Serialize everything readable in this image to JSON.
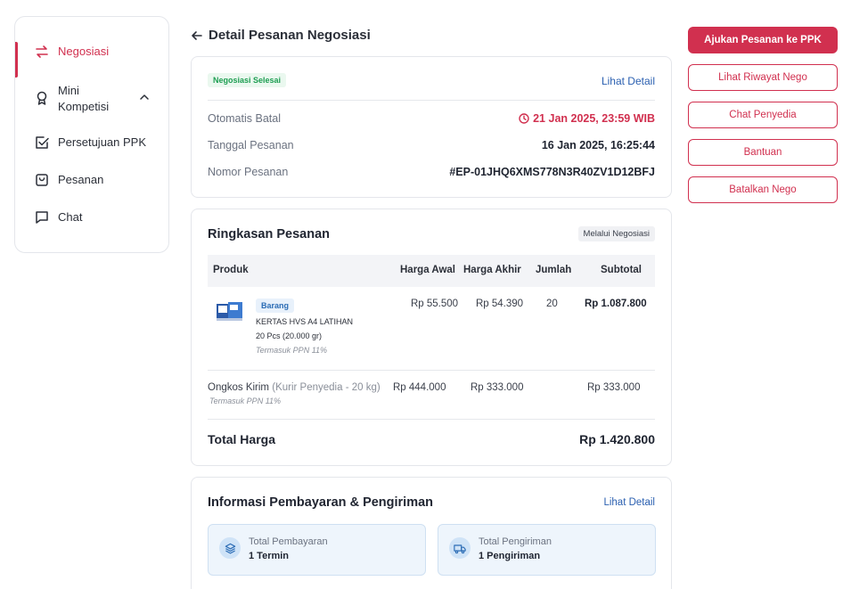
{
  "sidebar": {
    "items": [
      {
        "label": "Negosiasi",
        "icon": "arrows-swap-icon"
      },
      {
        "label": "Mini Kompetisi",
        "icon": "award-icon"
      },
      {
        "label": "Persetujuan PPK",
        "icon": "checkbox-icon"
      },
      {
        "label": "Pesanan",
        "icon": "shopping-bag-icon"
      },
      {
        "label": "Chat",
        "icon": "chat-icon"
      }
    ]
  },
  "header": {
    "title": "Detail Pesanan Negosiasi"
  },
  "status": {
    "badge": "Negosiasi Selesai",
    "detail_link": "Lihat Detail",
    "rows": [
      {
        "label": "Otomatis Batal",
        "value": "21 Jan 2025, 23:59 WIB"
      },
      {
        "label": "Tanggal Pesanan",
        "value": "16 Jan 2025, 16:25:44"
      },
      {
        "label": "Nomor Pesanan",
        "value": "#EP-01JHQ6XMS778N3R40ZV1D12BFJ"
      }
    ]
  },
  "summary": {
    "title": "Ringkasan Pesanan",
    "tag": "Melalui Negosiasi",
    "columns": [
      "Produk",
      "Harga Awal",
      "Harga Akhir",
      "Jumlah",
      "Subtotal"
    ],
    "product": {
      "type": "Barang",
      "name": "KERTAS HVS A4 LATIHAN",
      "qty_detail": "20 Pcs (20.000 gr)",
      "tax_note": "Termasuk PPN 11%",
      "harga_awal": "Rp 55.500",
      "harga_akhir": "Rp 54.390",
      "jumlah": "20",
      "subtotal": "Rp 1.087.800"
    },
    "shipping": {
      "label": "Ongkos Kirim",
      "detail": "(Kurir Penyedia - 20 kg)",
      "tax_note": "Termasuk PPN 11%",
      "harga_awal": "Rp 444.000",
      "harga_akhir": "Rp 333.000",
      "subtotal": "Rp 333.000"
    },
    "total_label": "Total Harga",
    "total_value": "Rp 1.420.800"
  },
  "payment": {
    "title": "Informasi Pembayaran & Pengiriman",
    "detail_link": "Lihat Detail",
    "boxes": [
      {
        "label": "Total Pembayaran",
        "value": "1 Termin",
        "icon": "layers-icon"
      },
      {
        "label": "Total Pengiriman",
        "value": "1 Pengiriman",
        "icon": "truck-icon"
      }
    ]
  },
  "actions": [
    "Ajukan Pesanan ke PPK",
    "Lihat Riwayat Nego",
    "Chat Penyedia",
    "Bantuan",
    "Batalkan Nego"
  ],
  "colors": {
    "accent": "#d1304f",
    "link": "#2a5fb0",
    "success": "#1e9e52"
  }
}
